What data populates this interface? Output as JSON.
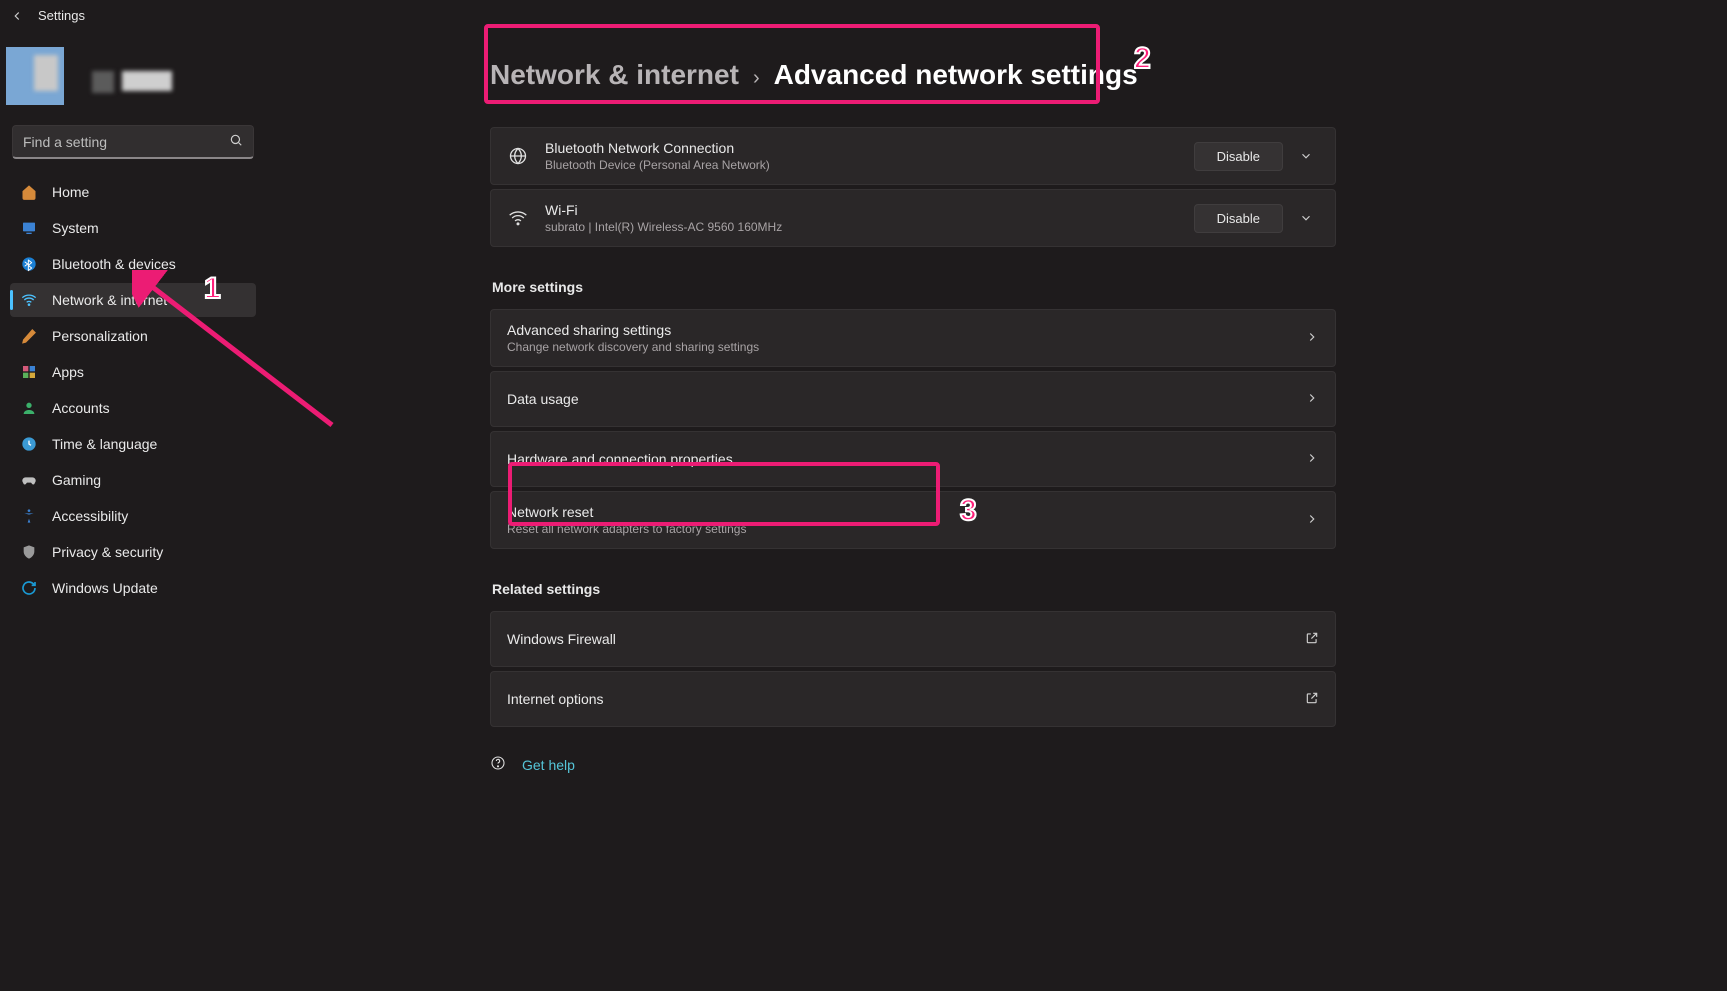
{
  "app_title": "Settings",
  "search": {
    "placeholder": "Find a setting"
  },
  "sidebar": {
    "items": [
      {
        "label": "Home",
        "id": "home"
      },
      {
        "label": "System",
        "id": "system"
      },
      {
        "label": "Bluetooth & devices",
        "id": "bluetooth"
      },
      {
        "label": "Network & internet",
        "id": "network",
        "selected": true
      },
      {
        "label": "Personalization",
        "id": "personalization"
      },
      {
        "label": "Apps",
        "id": "apps"
      },
      {
        "label": "Accounts",
        "id": "accounts"
      },
      {
        "label": "Time & language",
        "id": "time"
      },
      {
        "label": "Gaming",
        "id": "gaming"
      },
      {
        "label": "Accessibility",
        "id": "accessibility"
      },
      {
        "label": "Privacy & security",
        "id": "privacy"
      },
      {
        "label": "Windows Update",
        "id": "update"
      }
    ]
  },
  "breadcrumb": {
    "parent": "Network & internet",
    "chevron": "›",
    "current": "Advanced network settings"
  },
  "adapters": [
    {
      "title": "Bluetooth Network Connection",
      "subtitle": "Bluetooth Device (Personal Area Network)",
      "action_label": "Disable",
      "kind": "bluetooth"
    },
    {
      "title": "Wi-Fi",
      "subtitle": "subrato | Intel(R) Wireless-AC 9560 160MHz",
      "action_label": "Disable",
      "kind": "wifi"
    }
  ],
  "sections": {
    "more": "More settings",
    "related": "Related settings"
  },
  "more_settings": [
    {
      "title": "Advanced sharing settings",
      "subtitle": "Change network discovery and sharing settings"
    },
    {
      "title": "Data usage",
      "subtitle": ""
    },
    {
      "title": "Hardware and connection properties",
      "subtitle": ""
    },
    {
      "title": "Network reset",
      "subtitle": "Reset all network adapters to factory settings"
    }
  ],
  "related_settings": [
    {
      "title": "Windows Firewall"
    },
    {
      "title": "Internet options"
    }
  ],
  "get_help": "Get help",
  "annotation_numbers": {
    "one": "1",
    "two": "2",
    "three": "3"
  }
}
